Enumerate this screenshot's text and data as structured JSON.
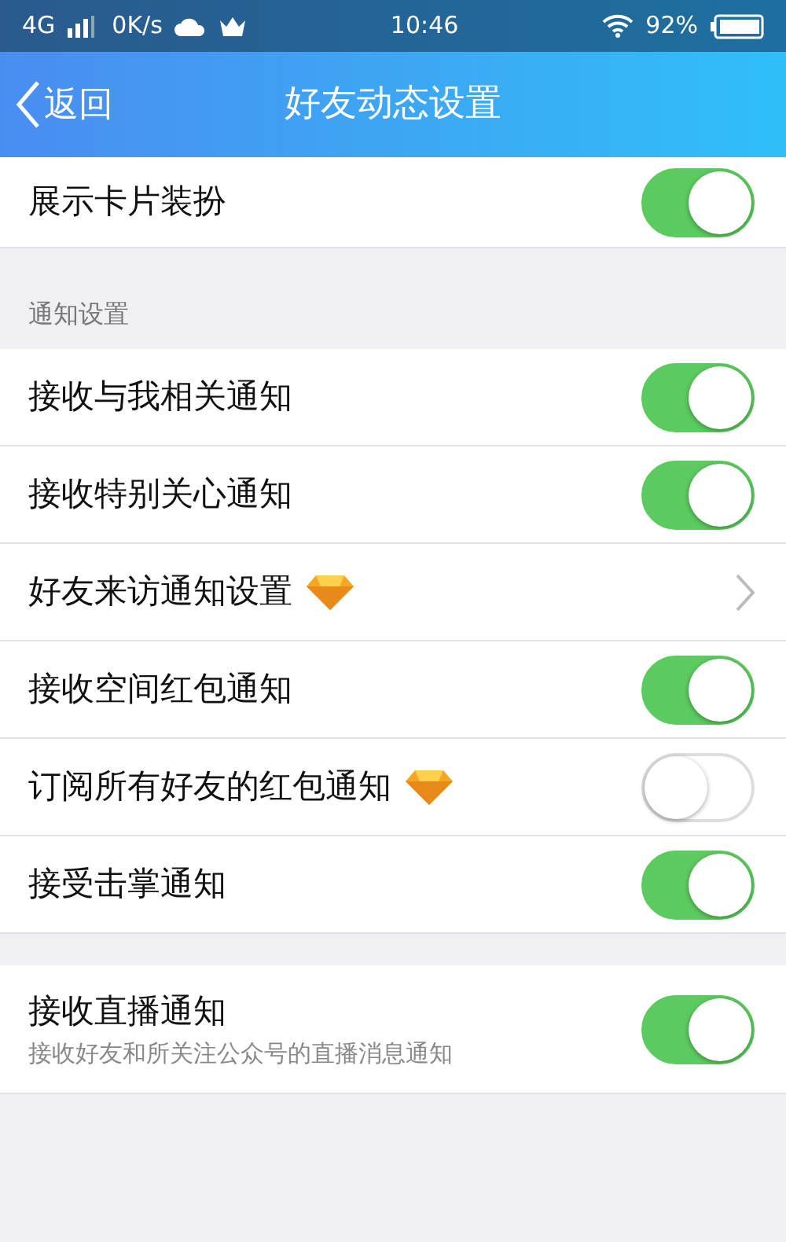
{
  "status_bar": {
    "network": "4G",
    "speed": "0K/s",
    "time": "10:46",
    "battery": "92%"
  },
  "nav_bar": {
    "back": "返回",
    "title": "好友动态设置"
  },
  "sections": [
    {
      "rows": [
        {
          "kind": "toggle",
          "label": "展示卡片装扮",
          "vip": false,
          "on": true
        }
      ]
    },
    {
      "header": "通知设置",
      "rows": [
        {
          "kind": "toggle",
          "label": "接收与我相关通知",
          "vip": false,
          "on": true
        },
        {
          "kind": "toggle",
          "label": "接收特别关心通知",
          "vip": false,
          "on": true
        },
        {
          "kind": "link",
          "label": "好友来访通知设置",
          "vip": true
        },
        {
          "kind": "toggle",
          "label": "接收空间红包通知",
          "vip": false,
          "on": true
        },
        {
          "kind": "toggle",
          "label": "订阅所有好友的红包通知",
          "vip": true,
          "on": false
        },
        {
          "kind": "toggle",
          "label": "接受击掌通知",
          "vip": false,
          "on": true
        }
      ]
    },
    {
      "rows": [
        {
          "kind": "toggle",
          "label": "接收直播通知",
          "subtitle": "接收好友和所关注公众号的直播消息通知",
          "vip": false,
          "on": true
        }
      ]
    }
  ]
}
